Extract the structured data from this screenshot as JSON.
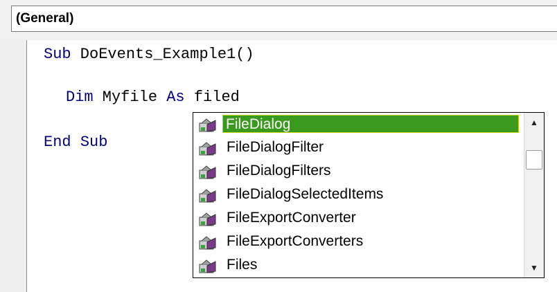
{
  "header": {
    "combo_value": "(General)"
  },
  "code": {
    "lines": [
      {
        "keyword1": "Sub",
        "text": " DoEvents_Example1()"
      },
      {
        "keyword1": "Dim",
        "text": " Myfile ",
        "keyword2": "As",
        "text2": " filed"
      },
      {
        "keyword1": "End",
        "text": " ",
        "keyword2": "Sub"
      }
    ]
  },
  "autocomplete": {
    "items": [
      {
        "label": "FileDialog",
        "icon": "class-icon"
      },
      {
        "label": "FileDialogFilter",
        "icon": "class-icon"
      },
      {
        "label": "FileDialogFilters",
        "icon": "class-icon"
      },
      {
        "label": "FileDialogSelectedItems",
        "icon": "class-icon"
      },
      {
        "label": "FileExportConverter",
        "icon": "class-icon"
      },
      {
        "label": "FileExportConverters",
        "icon": "class-icon"
      },
      {
        "label": "Files",
        "icon": "class-icon"
      }
    ],
    "selected_index": 0,
    "colors": {
      "selection": "#3a9a1e",
      "selection_border": "#c8d400",
      "keyword": "#00007f"
    }
  }
}
